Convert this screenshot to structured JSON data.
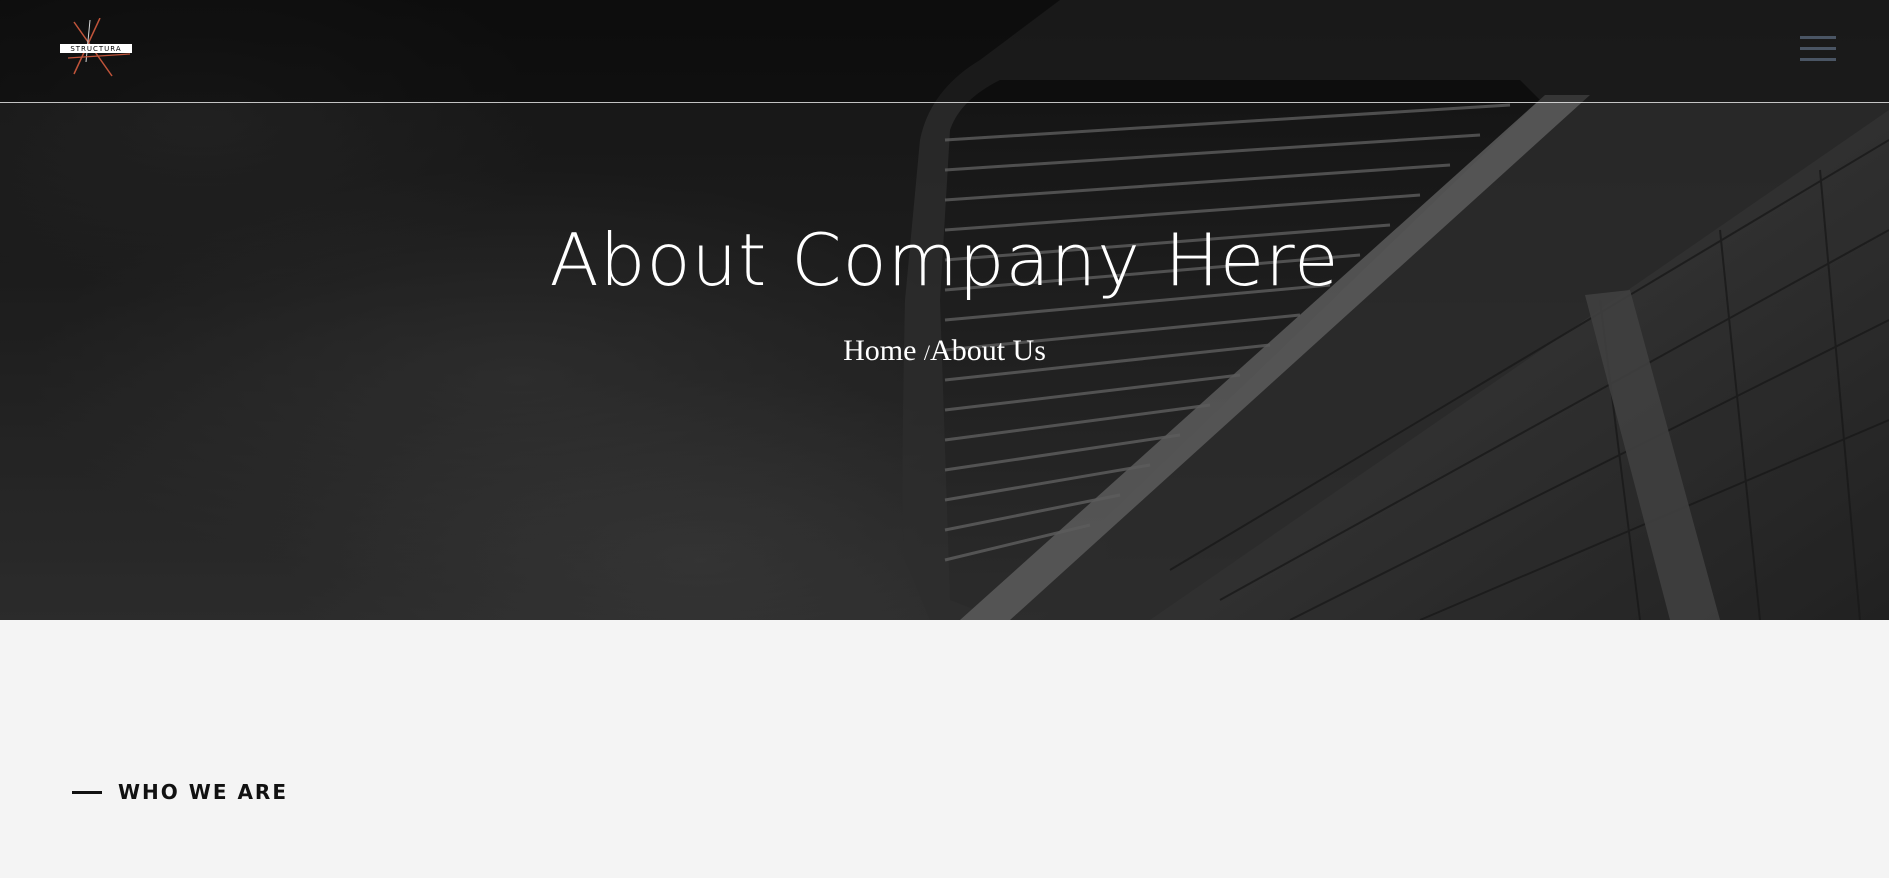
{
  "header": {
    "logo_text": "STRUCTURA",
    "menu_icon": "hamburger-menu-icon"
  },
  "hero": {
    "title": "About Company Here",
    "breadcrumb": {
      "home": "Home",
      "separator": "/",
      "current": "About Us"
    }
  },
  "section": {
    "label": "WHO WE ARE"
  },
  "colors": {
    "header_accent": "#c0543a",
    "menu_icon": "#4a5564",
    "page_background": "#f4f4f4"
  }
}
